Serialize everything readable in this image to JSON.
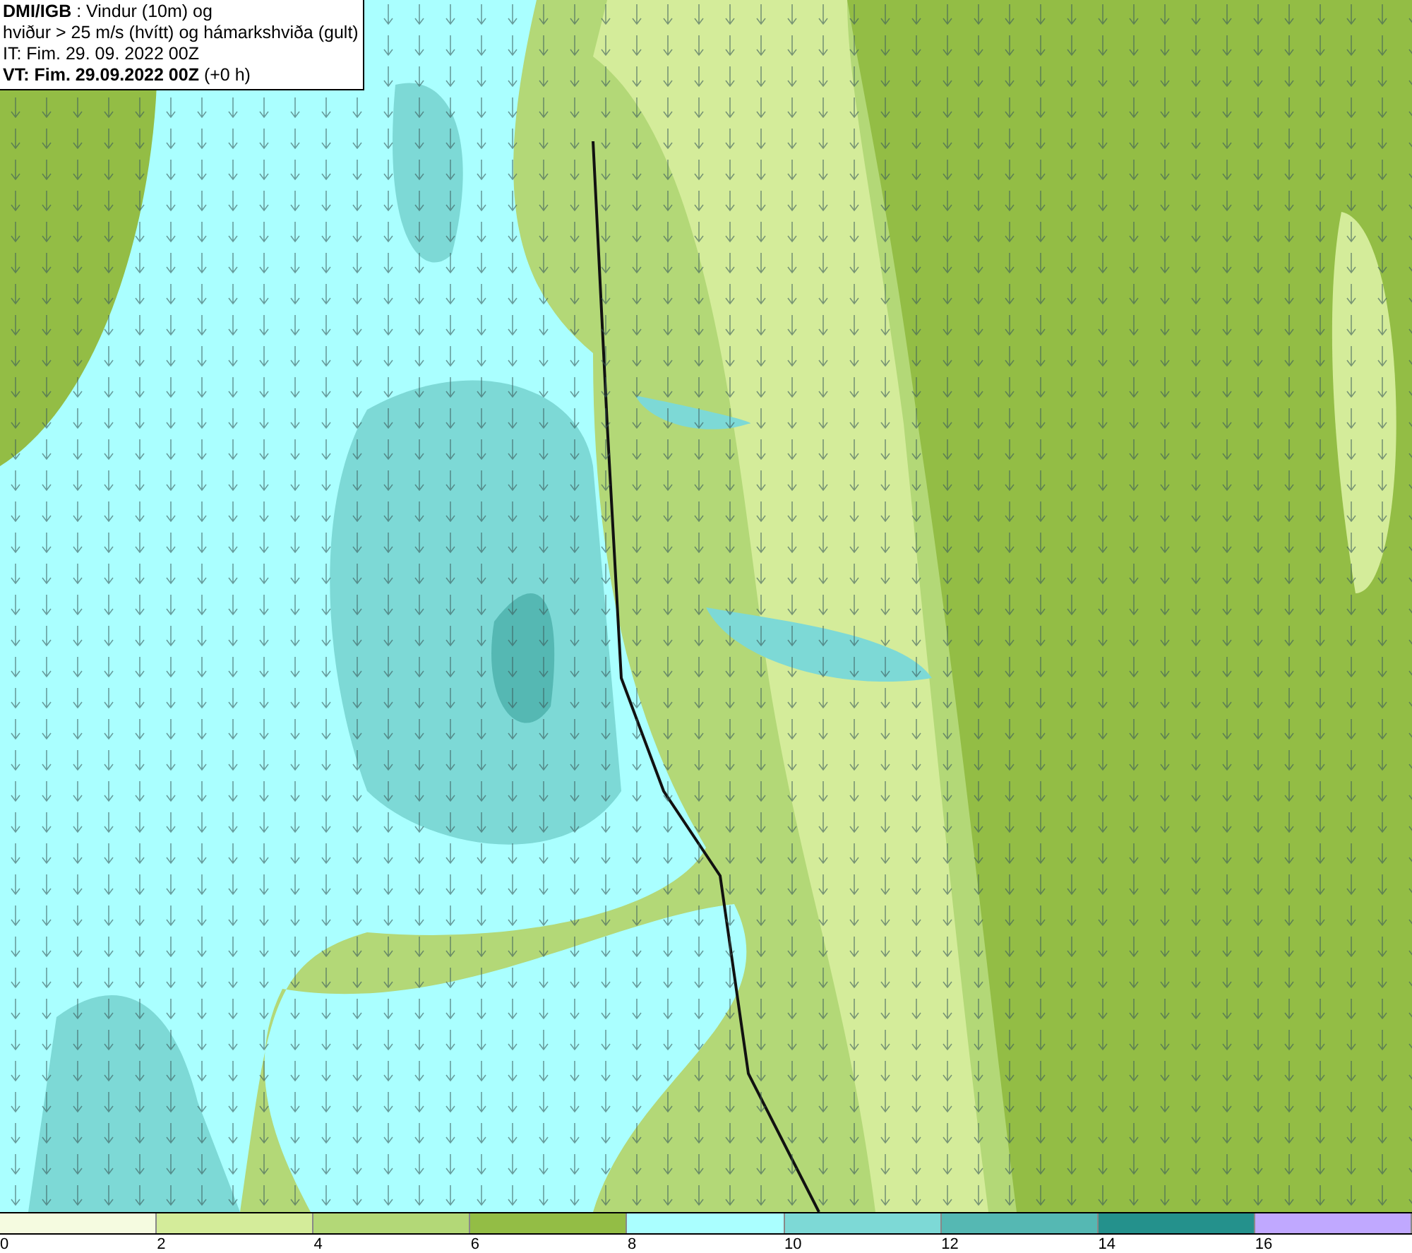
{
  "info_box": {
    "lines": [
      "**DMI/IGB** : Vindur (10m) og",
      "hviður > 25 m/s (hvítt) og hámarkshviða (gult)",
      "IT: Fim. 29. 09. 2022 00Z",
      "**VT: Fim. 29.09.2022 00Z** (+0 h)"
    ]
  },
  "legend": [
    {
      "color": "#f5fbe0",
      "label": "0"
    },
    {
      "color": "#d4ec9a",
      "label": "2"
    },
    {
      "color": "#b3d877",
      "label": "4"
    },
    {
      "color": "#93bd45",
      "label": "6"
    },
    {
      "color": "#aaffff",
      "label": "8"
    },
    {
      "color": "#7dd9d6",
      "label": "10"
    },
    {
      "color": "#55b8b3",
      "label": "12"
    },
    {
      "color": "#24918c",
      "label": "14"
    },
    {
      "color": "#c0a8ff",
      "label": "16"
    }
  ]
}
